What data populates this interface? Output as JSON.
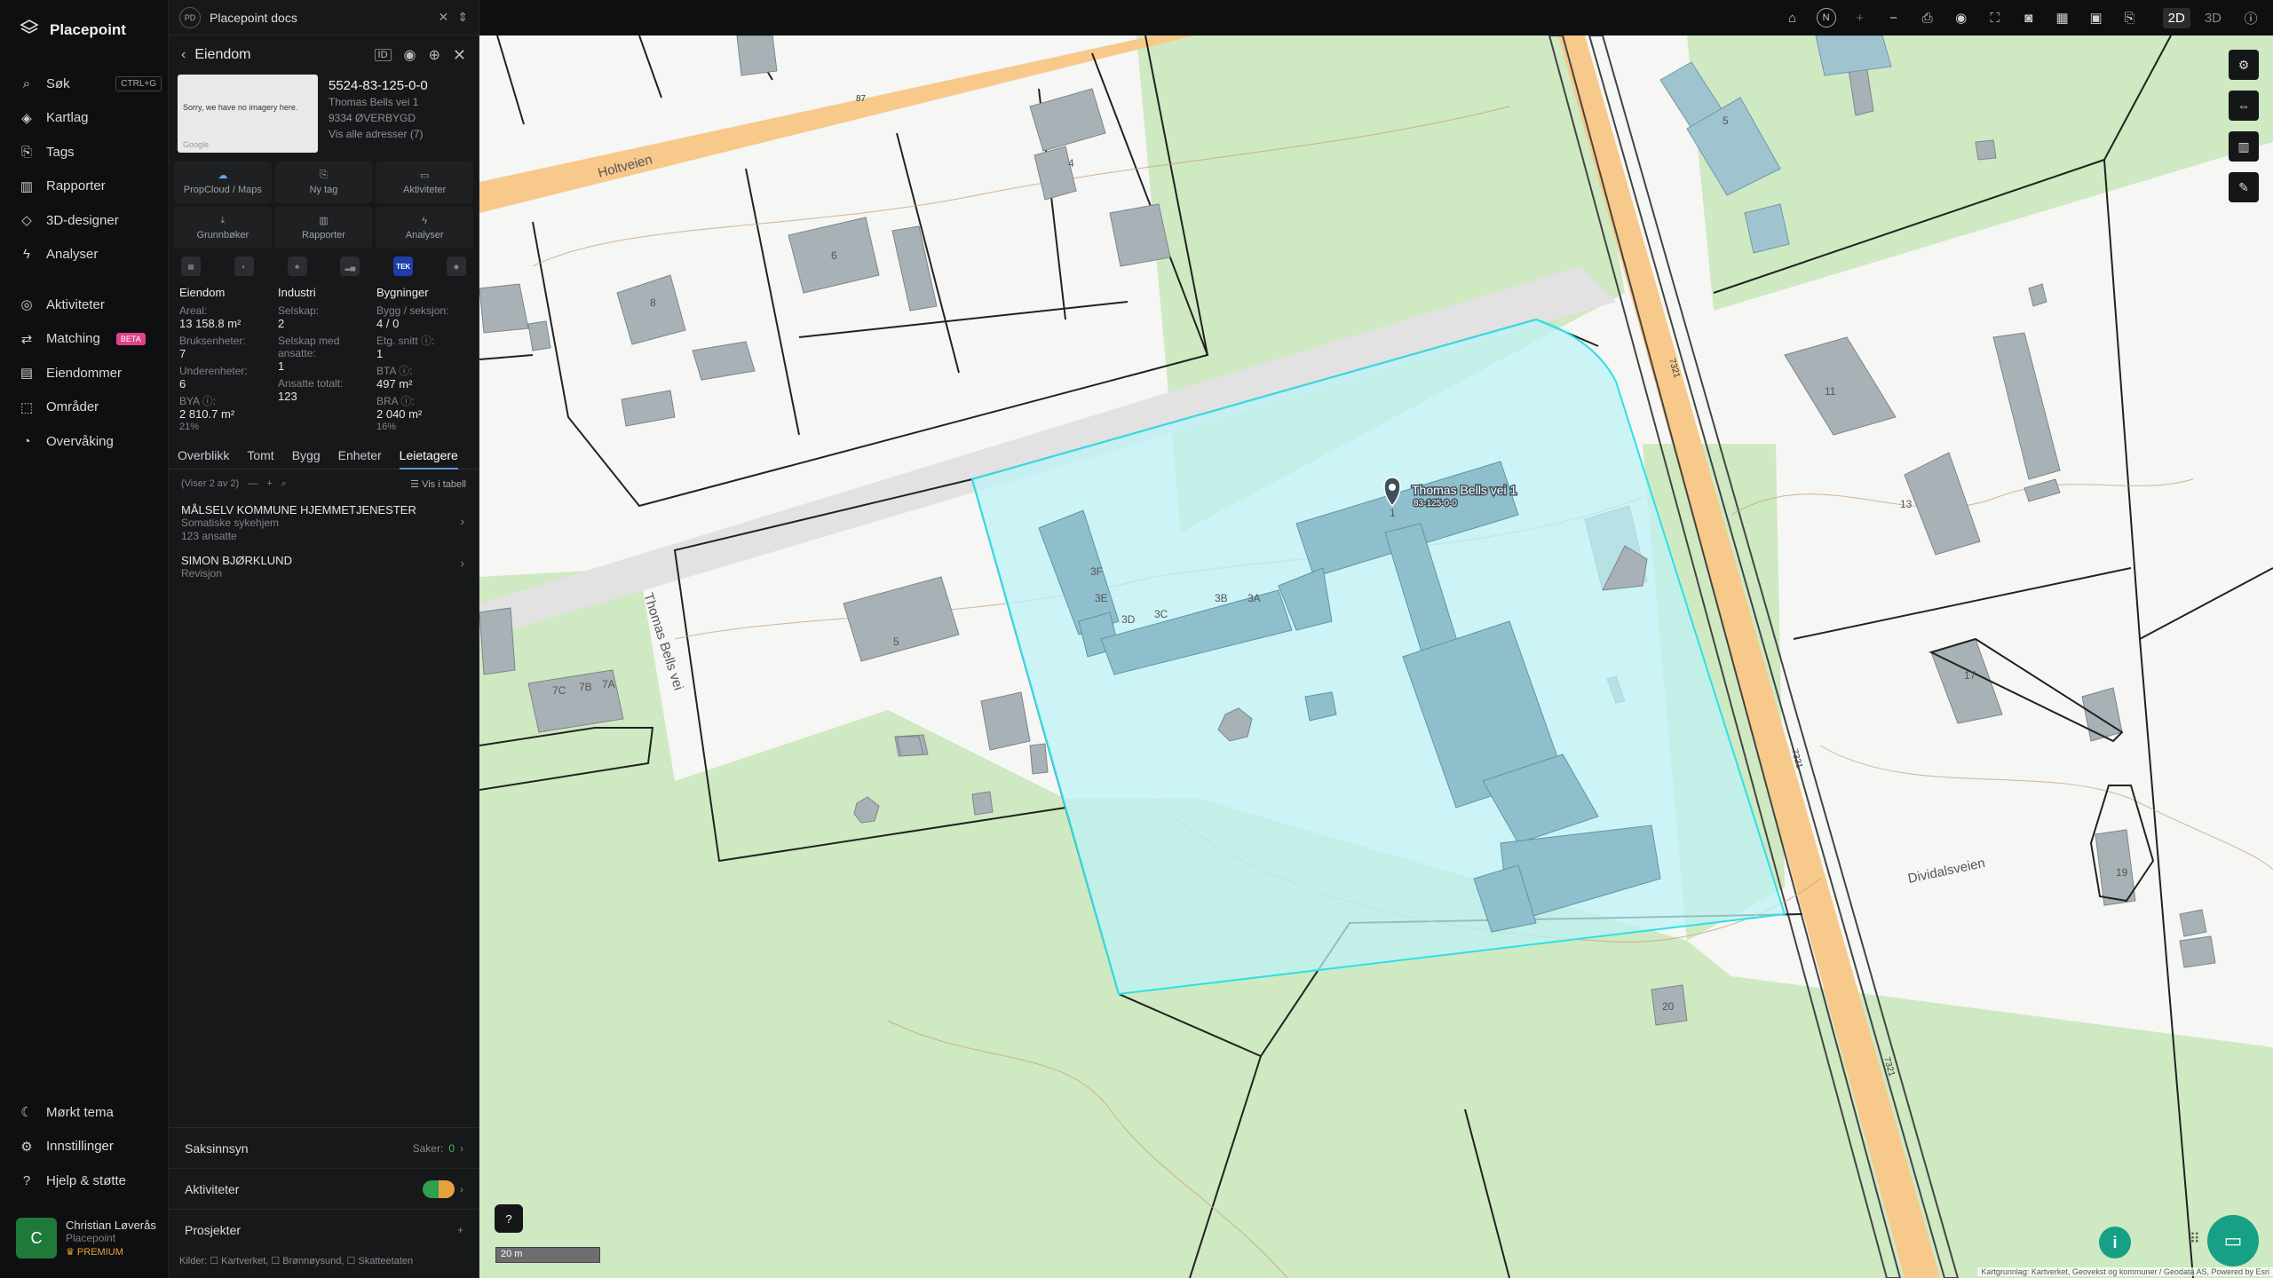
{
  "app": {
    "name": "Placepoint"
  },
  "nav": {
    "items": [
      {
        "label": "Søk",
        "icon": "search-icon",
        "shortcut": "CTRL+G"
      },
      {
        "label": "Kartlag",
        "icon": "layers-icon"
      },
      {
        "label": "Tags",
        "icon": "bookmark-icon"
      },
      {
        "label": "Rapporter",
        "icon": "bar-chart-icon"
      },
      {
        "label": "3D-designer",
        "icon": "cube-icon"
      },
      {
        "label": "Analyser",
        "icon": "bolt-icon"
      }
    ],
    "items2": [
      {
        "label": "Aktiviteter",
        "icon": "activity-icon"
      },
      {
        "label": "Matching",
        "icon": "match-icon",
        "badge": "BETA"
      },
      {
        "label": "Eiendommer",
        "icon": "building-icon"
      },
      {
        "label": "Områder",
        "icon": "area-icon"
      },
      {
        "label": "Overvåking",
        "icon": "monitor-icon"
      }
    ],
    "bottom": [
      {
        "label": "Mørkt tema",
        "icon": "moon-icon"
      },
      {
        "label": "Innstillinger",
        "icon": "gear-icon"
      },
      {
        "label": "Hjelp & støtte",
        "icon": "help-icon"
      }
    ],
    "user": {
      "initial": "C",
      "name": "Christian Løverås",
      "org": "Placepoint",
      "plan": "PREMIUM"
    }
  },
  "panel": {
    "doc_title": "Placepoint docs",
    "doc_badge": "PD",
    "header": "Eiendom",
    "prop_id": "5524-83-125-0-0",
    "address1": "Thomas Bells vei 1",
    "address2": "9334 ØVERBYGD",
    "address_link": "Vis alle adresser (7)",
    "thumb_text": "Sorry, we have no imagery here.",
    "thumb_credit": "Google",
    "actions": [
      "PropCloud / Maps",
      "Ny tag",
      "Aktiviteter",
      "Grunnbøker",
      "Rapporter",
      "Analyser"
    ],
    "tek_label": "TEK",
    "stats": {
      "eiendom": {
        "title": "Eiendom",
        "areal_label": "Areal:",
        "areal": "13 158.8 m²",
        "bruks_label": "Bruksenheter:",
        "bruks": "7",
        "under_label": "Underenheter:",
        "under": "6",
        "bya_label": "BYA ⓘ:",
        "bya": "2 810.7 m²",
        "bya_pct": "21%"
      },
      "industri": {
        "title": "Industri",
        "selskap_label": "Selskap:",
        "selskap": "2",
        "ansatte_label": "Selskap med ansatte:",
        "ansatte": "1",
        "totalt_label": "Ansatte totalt:",
        "totalt": "123"
      },
      "bygninger": {
        "title": "Bygninger",
        "bygg_label": "Bygg / seksjon:",
        "bygg": "4 / 0",
        "etg_label": "Etg. snitt ⓘ:",
        "etg": "1",
        "bta_label": "BTA ⓘ:",
        "bta": "497 m²",
        "bra_label": "BRA ⓘ:",
        "bra": "2 040 m²",
        "bra_pct": "16%"
      }
    },
    "tabs": [
      "Overblikk",
      "Tomt",
      "Bygg",
      "Enheter",
      "Leietagere"
    ],
    "active_tab": "Leietagere",
    "list_count": "(Viser 2 av 2)",
    "list_table": "Vis i tabell",
    "tenants": [
      {
        "name": "MÅLSELV KOMMUNE HJEMMETJENESTER",
        "desc": "Somatiske sykehjem",
        "extra": "123 ansatte"
      },
      {
        "name": "SIMON BJØRKLUND",
        "desc": "Revisjon",
        "extra": ""
      }
    ],
    "sections": {
      "saksinnsyn": "Saksinnsyn",
      "saker_label": "Saker:",
      "saker": "0",
      "aktiviteter": "Aktiviteter",
      "prosjekter": "Prosjekter"
    },
    "kilder": "Kilder: ☐ Kartverket, ☐ Brønnøysund, ☐ Skatteetaten"
  },
  "map": {
    "mode_2d": "2D",
    "mode_3d": "3D",
    "scale": "20 m",
    "marker_label": "Thomas Bells vei 1",
    "marker_sub": "83-125-0-0",
    "roads": [
      "Holtveien",
      "Thomas Bells vei",
      "Dividalsveien"
    ],
    "road_numbers": [
      "87",
      "7321",
      "7321",
      "7321"
    ],
    "house_numbers": [
      "8",
      "6",
      "4",
      "5",
      "11",
      "13",
      "17",
      "19",
      "20",
      "5",
      "7C",
      "7B",
      "7A",
      "1",
      "3F",
      "3E",
      "3D",
      "3C",
      "3B",
      "3A"
    ],
    "attribution": "Kartgrunnlag: Kartverket, Geovekst og kommuner / Geodata AS, Powered by Esri",
    "colors": {
      "highlight": "#2ee0e8",
      "building": "#9fc4d0",
      "green": "#cfe9c2",
      "road": "#f7c98a"
    }
  }
}
